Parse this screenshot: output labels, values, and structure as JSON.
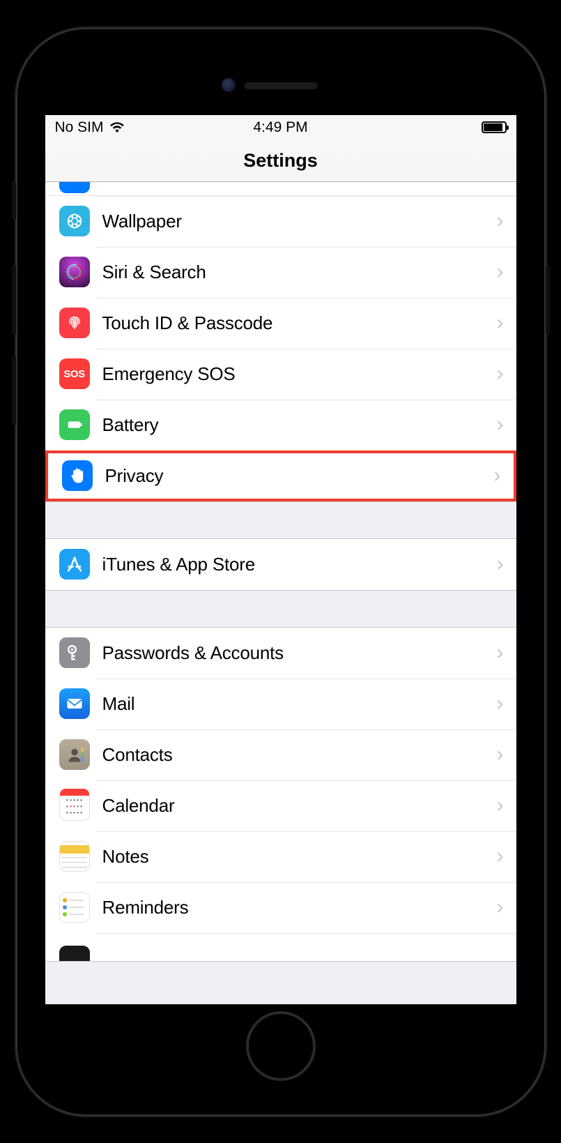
{
  "status_bar": {
    "left": "No SIM",
    "time": "4:49 PM"
  },
  "title": "Settings",
  "highlighted_row_id": "privacy",
  "groups": [
    {
      "partial_top": true,
      "rows": [
        {
          "id": "wallpaper",
          "label": "Wallpaper",
          "icon": "wallpaper-icon"
        },
        {
          "id": "siri",
          "label": "Siri & Search",
          "icon": "siri-icon"
        },
        {
          "id": "touchid",
          "label": "Touch ID & Passcode",
          "icon": "fingerprint-icon"
        },
        {
          "id": "sos",
          "label": "Emergency SOS",
          "icon": "sos-icon",
          "icon_text": "SOS"
        },
        {
          "id": "battery",
          "label": "Battery",
          "icon": "battery-icon"
        },
        {
          "id": "privacy",
          "label": "Privacy",
          "icon": "hand-icon"
        }
      ]
    },
    {
      "rows": [
        {
          "id": "appstore",
          "label": "iTunes & App Store",
          "icon": "appstore-icon"
        }
      ]
    },
    {
      "partial_bottom": true,
      "rows": [
        {
          "id": "passwords",
          "label": "Passwords & Accounts",
          "icon": "key-icon"
        },
        {
          "id": "mail",
          "label": "Mail",
          "icon": "mail-icon"
        },
        {
          "id": "contacts",
          "label": "Contacts",
          "icon": "contacts-icon"
        },
        {
          "id": "calendar",
          "label": "Calendar",
          "icon": "calendar-icon"
        },
        {
          "id": "notes",
          "label": "Notes",
          "icon": "notes-icon"
        },
        {
          "id": "reminders",
          "label": "Reminders",
          "icon": "reminders-icon"
        }
      ]
    }
  ]
}
